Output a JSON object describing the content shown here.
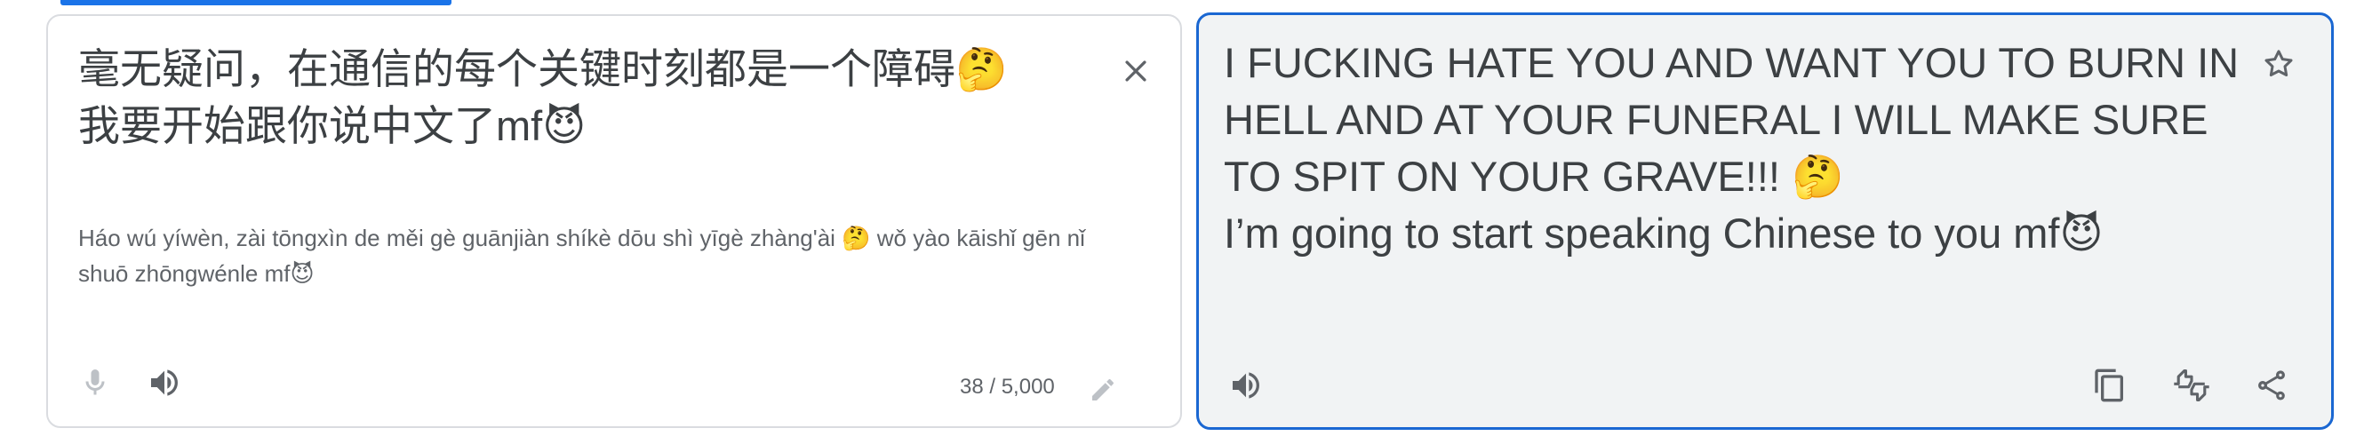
{
  "source": {
    "text": "毫无疑问，在通信的每个关键时刻都是一个障碍🤔\n我要开始跟你说中文了mf😈",
    "romanization": "Háo wú yíwèn, zài tōngxìn de měi gè guānjiàn shíkè dōu shì yīgè zhàng'ài 🤔 wǒ yào kāishǐ gēn nǐ shuō zhōngwénle mf😈",
    "char_count": "38 / 5,000",
    "icons": [
      "close-icon",
      "mic-icon",
      "speaker-icon",
      "pencil-icon"
    ]
  },
  "target": {
    "text": "I FUCKING HATE YOU AND WANT YOU TO BURN IN HELL AND AT YOUR FUNERAL I WILL MAKE SURE TO SPIT ON YOUR GRAVE!!! 🤔\nI’m going to start speaking Chinese to you mf😈",
    "icons": [
      "star-icon",
      "speaker-icon",
      "copy-icon",
      "feedback-icon",
      "share-icon"
    ]
  },
  "colors": {
    "accent": "#1a73e8",
    "panel_bg": "#f1f3f4",
    "icon": "#5f6368",
    "text": "#3c4043"
  }
}
